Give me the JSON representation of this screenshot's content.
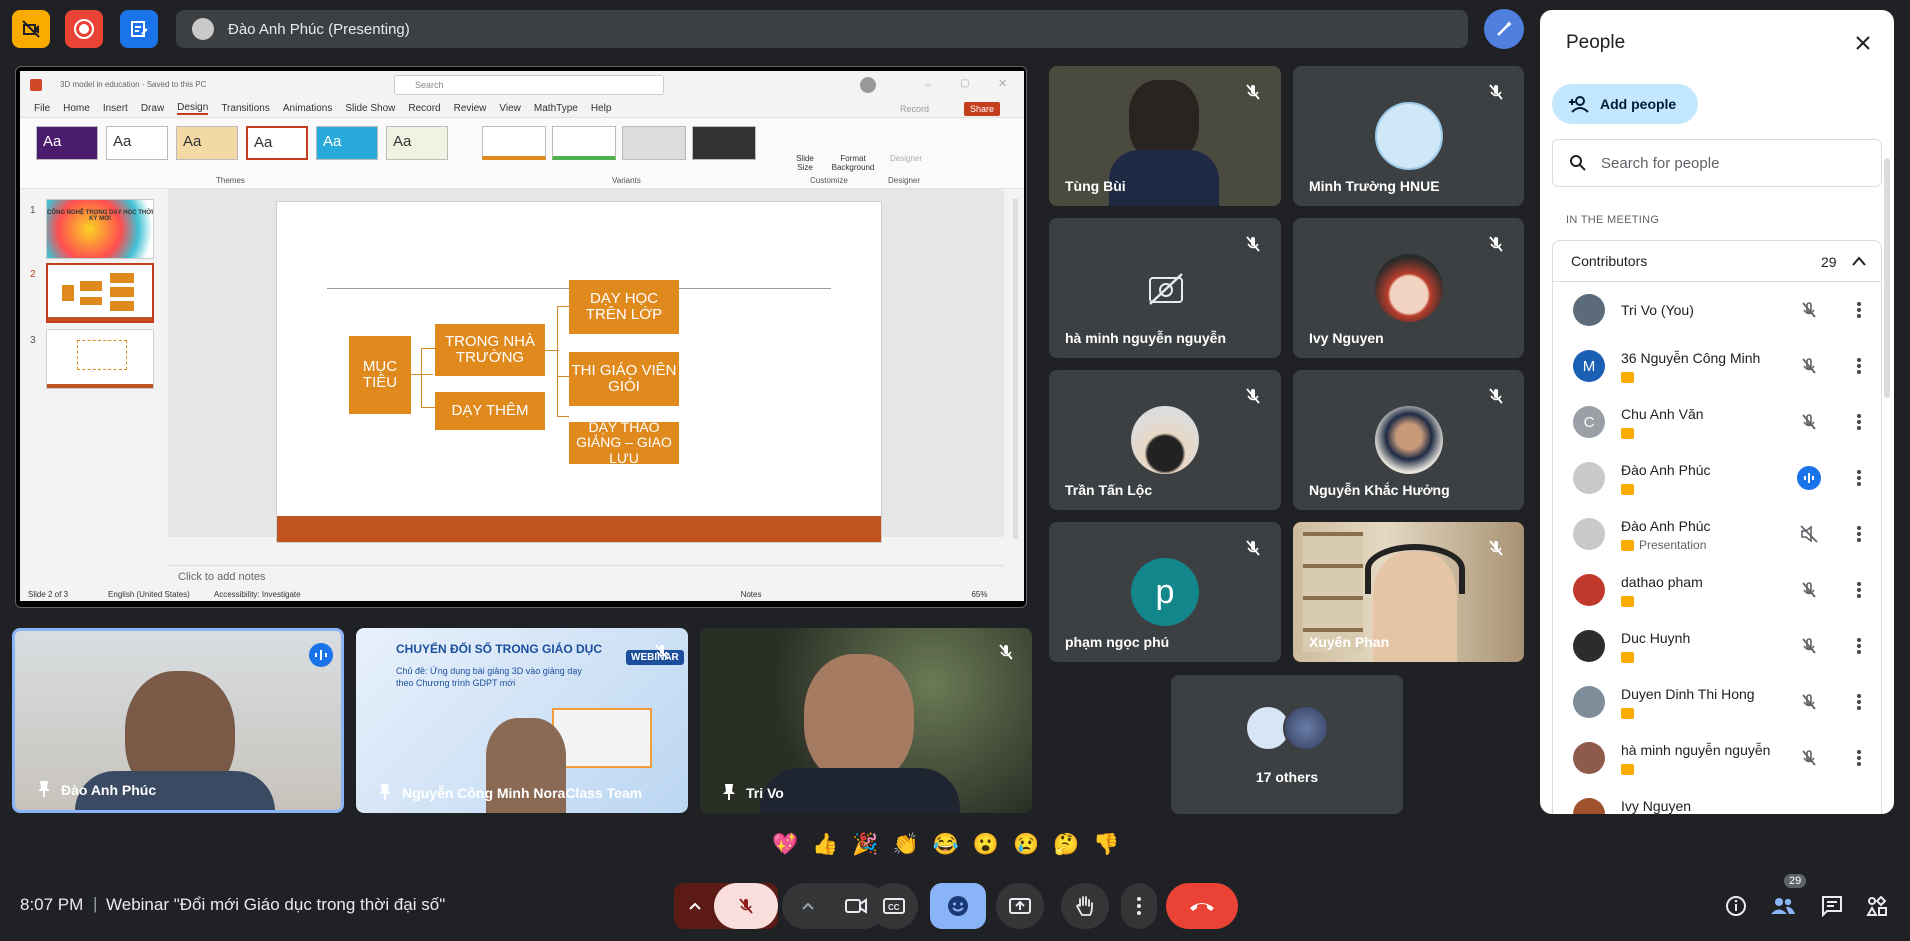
{
  "top": {
    "presenter": "Đào Anh Phúc (Presenting)"
  },
  "ppt": {
    "doc_title": "3D model in education · Saved to this PC",
    "search_placeholder": "Search",
    "record_label": "Record",
    "share_label": "Share",
    "menu": [
      "File",
      "Home",
      "Insert",
      "Draw",
      "Design",
      "Transitions",
      "Animations",
      "Slide Show",
      "Record",
      "Review",
      "View",
      "MathType",
      "Help"
    ],
    "theme_sample": "Aa",
    "ribbon_labels": {
      "themes": "Themes",
      "variants": "Variants",
      "customize": "Customize",
      "designer": "Designer"
    },
    "ribbon_buttons": {
      "slide_size": "Slide Size",
      "format_bg": "Format Background",
      "designer": "Designer"
    },
    "thumb_numbers": [
      "1",
      "2",
      "3"
    ],
    "thumb1_text": "CÔNG NGHỆ TRONG DẠY HỌC THỜI KỲ MỚI",
    "slide": {
      "muc_tieu": "MỤC TIÊU",
      "trong_nha_truong": "TRONG NHÀ TRƯỜNG",
      "day_them": "DẠY THÊM",
      "day_hoc_tren_lop": "DẠY HỌC TRÊN LỚP",
      "thi_giao_vien_gioi": "THI GIÁO VIÊN GIỎI",
      "day_thao_giang": "DẠY THAO GIẢNG – GIAO LƯU"
    },
    "notes_placeholder": "Click to add notes",
    "status": {
      "slide": "Slide 2 of 3",
      "lang": "English (United States)",
      "accessibility": "Accessibility: Investigate",
      "notes": "Notes",
      "zoom": "65%"
    }
  },
  "tiles": [
    {
      "name": "Tùng Bùi"
    },
    {
      "name": "Minh Trường HNUE"
    },
    {
      "name": "hà minh nguyễn nguyễn"
    },
    {
      "name": "Ivy Nguyen"
    },
    {
      "name": "Trần Tấn Lộc"
    },
    {
      "name": "Nguyễn Khắc Hưởng"
    },
    {
      "name": "phạm ngọc phú",
      "initial": "p"
    },
    {
      "name": "Xuyến Phan"
    }
  ],
  "others": {
    "label": "17 others"
  },
  "big_tiles": [
    {
      "name": "Đào Anh Phúc"
    },
    {
      "name": "Nguyễn Công Minh NoraClass Team",
      "webinar_badge": "WEBINAR",
      "banner": "CHUYỂN ĐỔI SỐ TRONG GIÁO DỤC",
      "banner_sub": "Chủ đề: Ứng dụng bài giảng 3D vào giảng dạy theo Chương trình GDPT mới"
    },
    {
      "name": "Tri Vo"
    }
  ],
  "reactions": [
    "💖",
    "👍",
    "🎉",
    "👏",
    "😂",
    "😮",
    "😢",
    "🤔",
    "👎"
  ],
  "bottom": {
    "time": "8:07 PM",
    "separator": "|",
    "title": "Webinar \"Đổi mới Giáo dục trong thời đại số\"",
    "people_count": "29"
  },
  "panel": {
    "title": "People",
    "add_people": "Add people",
    "search_placeholder": "Search for people",
    "section": "IN THE MEETING",
    "contributors_label": "Contributors",
    "contributors_count": "29",
    "people": [
      {
        "name": "Tri Vo (You)",
        "color": "#5b6b7a"
      },
      {
        "name": "36 Nguyễn Công Minh",
        "initial": "M",
        "color": "#1a5fb4"
      },
      {
        "name": "Chu Anh Văn",
        "initial": "C",
        "color": "#9aa0a6"
      },
      {
        "name": "Đào Anh Phúc",
        "color": "#c9c9c9"
      },
      {
        "name": "Đào Anh Phúc",
        "sub": "Presentation",
        "color": "#c9c9c9"
      },
      {
        "name": "dathao pham",
        "color": "#c0392b"
      },
      {
        "name": "Duc Huynh",
        "color": "#2c2c2c"
      },
      {
        "name": "Duyen Dinh Thi Hong",
        "color": "#7f8c9a"
      },
      {
        "name": "hà minh nguyễn nguyễn",
        "color": "#8e5a4a"
      },
      {
        "name": "Ivy Nguyen",
        "color": "#a0522d"
      }
    ]
  },
  "colors": {
    "accent": "#1a73e8",
    "end_call": "#ea4335",
    "slide_orange": "#e08a1e"
  }
}
